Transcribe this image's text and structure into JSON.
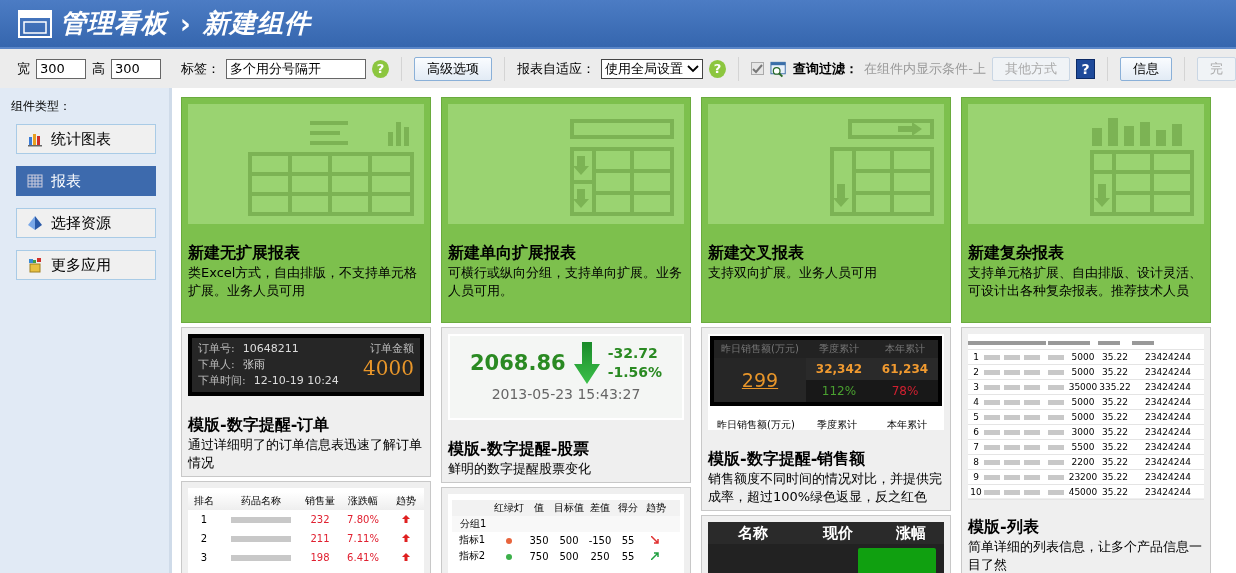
{
  "header": {
    "title": "管理看板",
    "separator": "›",
    "subtitle": "新建组件"
  },
  "toolbar": {
    "width_label": "宽",
    "width_value": "300",
    "height_label": "高",
    "height_value": "300",
    "tag_label": "标签：",
    "tag_value": "多个用分号隔开",
    "advanced_button": "高级选项",
    "tag_help": "?",
    "adapt_label": "报表自适应：",
    "adapt_value": "使用全局设置",
    "adapt_help": "?",
    "filter_checked": true,
    "filter_disabled": true,
    "filter_label": "查询过滤：",
    "filter_value": "在组件内显示条件-上",
    "help_mark": "?",
    "buttons": [
      {
        "label": "其他方式",
        "disabled": true
      },
      {
        "label": "信息",
        "disabled": false
      },
      {
        "label": "完",
        "disabled": true
      }
    ]
  },
  "sidebar": {
    "title": "组件类型：",
    "items": [
      {
        "label": "统计图表",
        "kind": "chart",
        "selected": false
      },
      {
        "label": "报表",
        "kind": "grid",
        "selected": true
      },
      {
        "label": "选择资源",
        "kind": "pyramid",
        "selected": false
      },
      {
        "label": "更多应用",
        "kind": "box",
        "selected": false
      }
    ]
  },
  "columns": [
    {
      "cards": [
        {
          "kind": "flat",
          "title": "新建无扩展报表",
          "description": "类Excel方式，自由排版，不支持单元格扩展。业务人员可用"
        },
        {
          "kind": "order",
          "title": "模版-数字提醒-订单",
          "description": "通过详细明了的订单信息表迅速了解订单情况",
          "preview": {
            "lines": [
              {
                "label": "订单号:",
                "value": "10648211"
              },
              {
                "label": "下单人:",
                "value": "张雨"
              },
              {
                "label": "下单时间:",
                "value": "12-10-19 10:24"
              }
            ],
            "amount_label": "订单金额",
            "amount": "4000"
          }
        },
        {
          "kind": "rank",
          "preview": {
            "columns": [
              "排名",
              "药品名称",
              "销售量",
              "涨跌幅",
              "趋势"
            ],
            "rows": [
              {
                "rank": "1",
                "sales": "232",
                "change": "7.80%",
                "up": true
              },
              {
                "rank": "2",
                "sales": "211",
                "change": "7.11%",
                "up": true
              },
              {
                "rank": "3",
                "sales": "198",
                "change": "6.41%",
                "up": true
              }
            ]
          }
        }
      ]
    },
    {
      "cards": [
        {
          "kind": "single",
          "title": "新建单向扩展报表",
          "description": "可横行或纵向分组，支持单向扩展。业务人员可用。"
        },
        {
          "kind": "stock",
          "title": "模版-数字提醒-股票",
          "description": "鲜明的数字提醒股票变化",
          "preview": {
            "price": "2068.86",
            "change": "-32.72",
            "percent": "-1.56%",
            "time": "2013-05-23 15:43:27"
          }
        },
        {
          "kind": "kpi",
          "preview": {
            "status_header": "红绿灯",
            "value_headers": [
              "值",
              "目标值",
              "差值",
              "得分"
            ],
            "trend_header": "趋势",
            "group": "分组1",
            "rows": [
              {
                "name": "指标1",
                "color": "#e8643c",
                "cells": [
                  "350",
                  "500",
                  "-150",
                  "55"
                ],
                "up": false
              },
              {
                "name": "指标2",
                "color": "#3cb04a",
                "cells": [
                  "750",
                  "500",
                  "250",
                  "55"
                ],
                "up": true
              }
            ]
          }
        }
      ]
    },
    {
      "cards": [
        {
          "kind": "cross",
          "title": "新建交叉报表",
          "description": "支持双向扩展。业务人员可用"
        },
        {
          "kind": "sales",
          "title": "模版-数字提醒-销售额",
          "description": "销售额度不同时间的情况对比，并提供完成率，超过100%绿色返显，反之红色",
          "preview": {
            "headers": [
              "昨日销售额(万元)",
              "季度累计",
              "本年累计"
            ],
            "main": "299",
            "totals": [
              "32,342",
              "61,234"
            ],
            "rates": [
              "112%",
              "78%"
            ],
            "footers": [
              "昨日销售额(万元)",
              "季度累计",
              "本年累计"
            ]
          }
        },
        {
          "kind": "quote",
          "preview": {
            "columns": [
              "名称",
              "现价",
              "涨幅"
            ]
          }
        }
      ]
    },
    {
      "cards": [
        {
          "kind": "complex",
          "title": "新建复杂报表",
          "description": "支持单元格扩展、自由排版、设计灵活、可设计出各种复杂报表。推荐技术人员"
        },
        {
          "kind": "list",
          "title": "模版-列表",
          "description": "简单详细的列表信息，让多个产品信息一目了然",
          "preview": {
            "rows": [
              [
                "1",
                "5000",
                "35.22",
                "23424244"
              ],
              [
                "2",
                "5000",
                "35.22",
                "23424244"
              ],
              [
                "3",
                "35000",
                "335.22",
                "23424244"
              ],
              [
                "4",
                "5000",
                "35.22",
                "23424244"
              ],
              [
                "5",
                "5000",
                "35.22",
                "23424244"
              ],
              [
                "6",
                "3000",
                "35.22",
                "23424244"
              ],
              [
                "7",
                "5500",
                "35.22",
                "23424244"
              ],
              [
                "8",
                "2200",
                "35.22",
                "23424244"
              ],
              [
                "9",
                "23200",
                "35.22",
                "23424244"
              ],
              [
                "10",
                "45000",
                "35.22",
                "23424244"
              ]
            ]
          }
        }
      ]
    }
  ]
}
